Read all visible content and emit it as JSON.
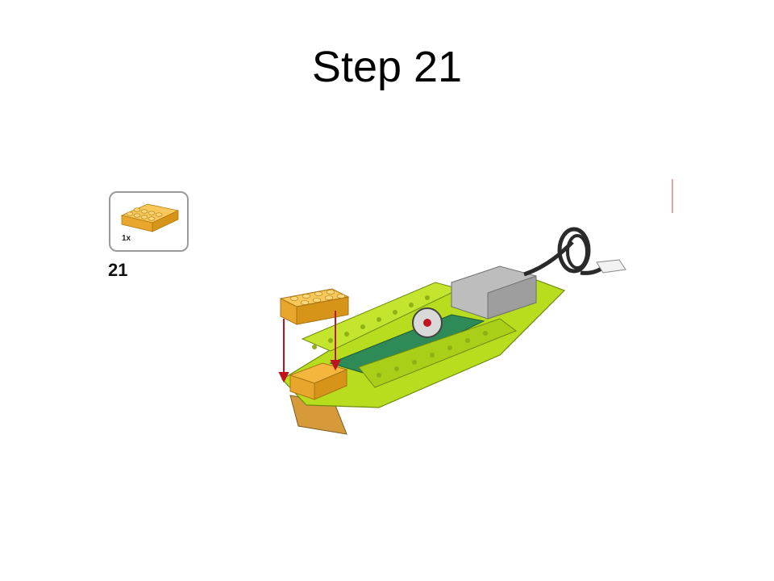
{
  "slide": {
    "title": "Step 21"
  },
  "parts_callout": {
    "quantity": "1x",
    "part_icon": "yellow-2x4-brick-icon",
    "part_color": "#F4B63D"
  },
  "step_number": "21",
  "model": {
    "icon": "lego-build-model-illustration",
    "colors": {
      "lime": "#B7DD1E",
      "yellow": "#F4B63D",
      "green": "#2E8B57",
      "gray": "#B8B8B8",
      "cable": "#2A2A2A",
      "arrow": "#C0141C"
    }
  }
}
